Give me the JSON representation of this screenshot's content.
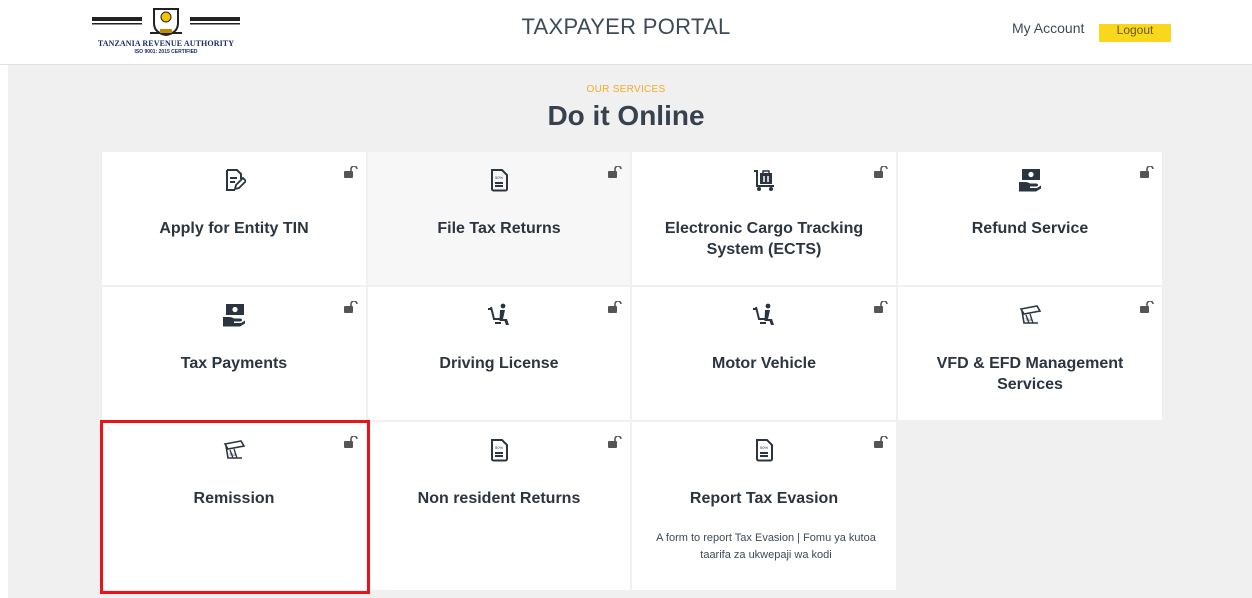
{
  "header": {
    "logo_text": "TANZANIA REVENUE AUTHORITY",
    "logo_sub": "ISO 9001: 2015 CERTIFIED",
    "title": "TAXPAYER PORTAL",
    "my_account": "My Account",
    "logout": "Logout"
  },
  "services": {
    "eyebrow": "OUR SERVICES",
    "heading": "Do it Online",
    "tiles": [
      {
        "label": "Apply for Entity TIN",
        "icon": "edit-document-icon"
      },
      {
        "label": "File Tax Returns",
        "icon": "document-icon"
      },
      {
        "label": "Electronic Cargo Tracking System (ECTS)",
        "icon": "cargo-trolley-icon"
      },
      {
        "label": "Refund Service",
        "icon": "hand-money-icon"
      },
      {
        "label": "Tax Payments",
        "icon": "hand-money-icon"
      },
      {
        "label": "Driving License",
        "icon": "car-seat-icon"
      },
      {
        "label": "Motor Vehicle",
        "icon": "car-seat-icon"
      },
      {
        "label": "VFD & EFD Management Services",
        "icon": "receipt-printer-icon"
      },
      {
        "label": "Remission",
        "icon": "receipt-printer-icon"
      },
      {
        "label": "Non resident Returns",
        "icon": "document-icon"
      },
      {
        "label": "Report Tax Evasion",
        "icon": "document-icon",
        "description": "A form to report Tax Evasion | Fomu ya kutoa taarifa za ukwepaji wa kodi"
      }
    ]
  },
  "colors": {
    "accent": "#f0ad2b",
    "logout_bg": "#f9d71c",
    "highlight": "#e8141b"
  }
}
